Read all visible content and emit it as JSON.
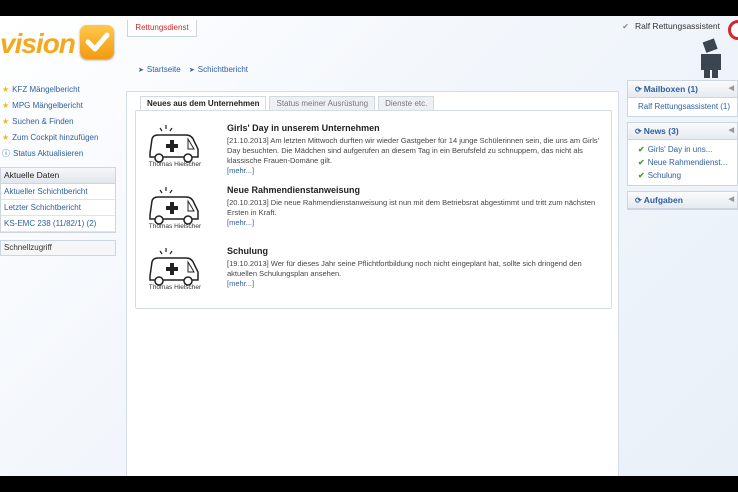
{
  "logo": {
    "text": "vision"
  },
  "header": {
    "tab_label": "Rettungsdienst",
    "user_name": "Ralf Rettungsassistent"
  },
  "breadcrumb": [
    "Startseite",
    "Schichtbericht"
  ],
  "left_menu": [
    {
      "icon": "star-icon",
      "label": "KFZ Mängelbericht"
    },
    {
      "icon": "star-icon",
      "label": "MPG Mängelbericht"
    },
    {
      "icon": "star-icon",
      "label": "Suchen & Finden"
    },
    {
      "icon": "star-icon",
      "label": "Zum Cockpit hinzufügen"
    },
    {
      "icon": "info-icon",
      "label": "Status Aktualisieren"
    }
  ],
  "current_data": {
    "header": "Aktuelle Daten",
    "items": [
      "Aktueller Schichtbericht",
      "Letzter Schichtbericht",
      "KS-EMC 238 (11/82/1) (2)"
    ]
  },
  "quick_access": "Schnellzugriff",
  "main": {
    "tabs": [
      "Neues aus dem Unternehmen",
      "Status meiner Ausrüstung",
      "Dienste etc."
    ],
    "news": [
      {
        "title": "Girls' Day in unserem Unternehmen",
        "body": "[21.10.2013] Am letzten Mittwoch durften wir wieder Gastgeber für 14 junge Schülerinnen sein, die uns am Girls' Day besuchten. Die Mädchen sind aufgerufen an diesem Tag in ein Berufsfeld zu schnuppern, das nicht als klassische Frauen-Domäne gilt.",
        "more": "[mehr...]",
        "author": "Thomas Hielscher"
      },
      {
        "title": "Neue Rahmendienstanweisung",
        "body": "[20.10.2013] Die neue Rahmendienstanweisung ist nun mit dem Betriebsrat abgestimmt und tritt zum nächsten Ersten in Kraft.",
        "more": "[mehr...]",
        "author": "Thomas Hielscher"
      },
      {
        "title": "Schulung",
        "body": "[19.10.2013] Wer für dieses Jahr seine Pflichtfortbildung noch nicht eingeplant hat, sollte sich dringend den aktuellen Schulungsplan ansehen.",
        "more": "[mehr...]",
        "author": "Thomas Hielscher"
      }
    ]
  },
  "right": {
    "mailboxes": {
      "title": "Mailboxen (1)",
      "items": [
        "Ralf Rettungsassistent (1)"
      ]
    },
    "news": {
      "title": "News (3)",
      "items": [
        "Girls' Day in uns...",
        "Neue Rahmendienst...",
        "Schulung"
      ]
    },
    "tasks": {
      "title": "Aufgaben"
    }
  }
}
